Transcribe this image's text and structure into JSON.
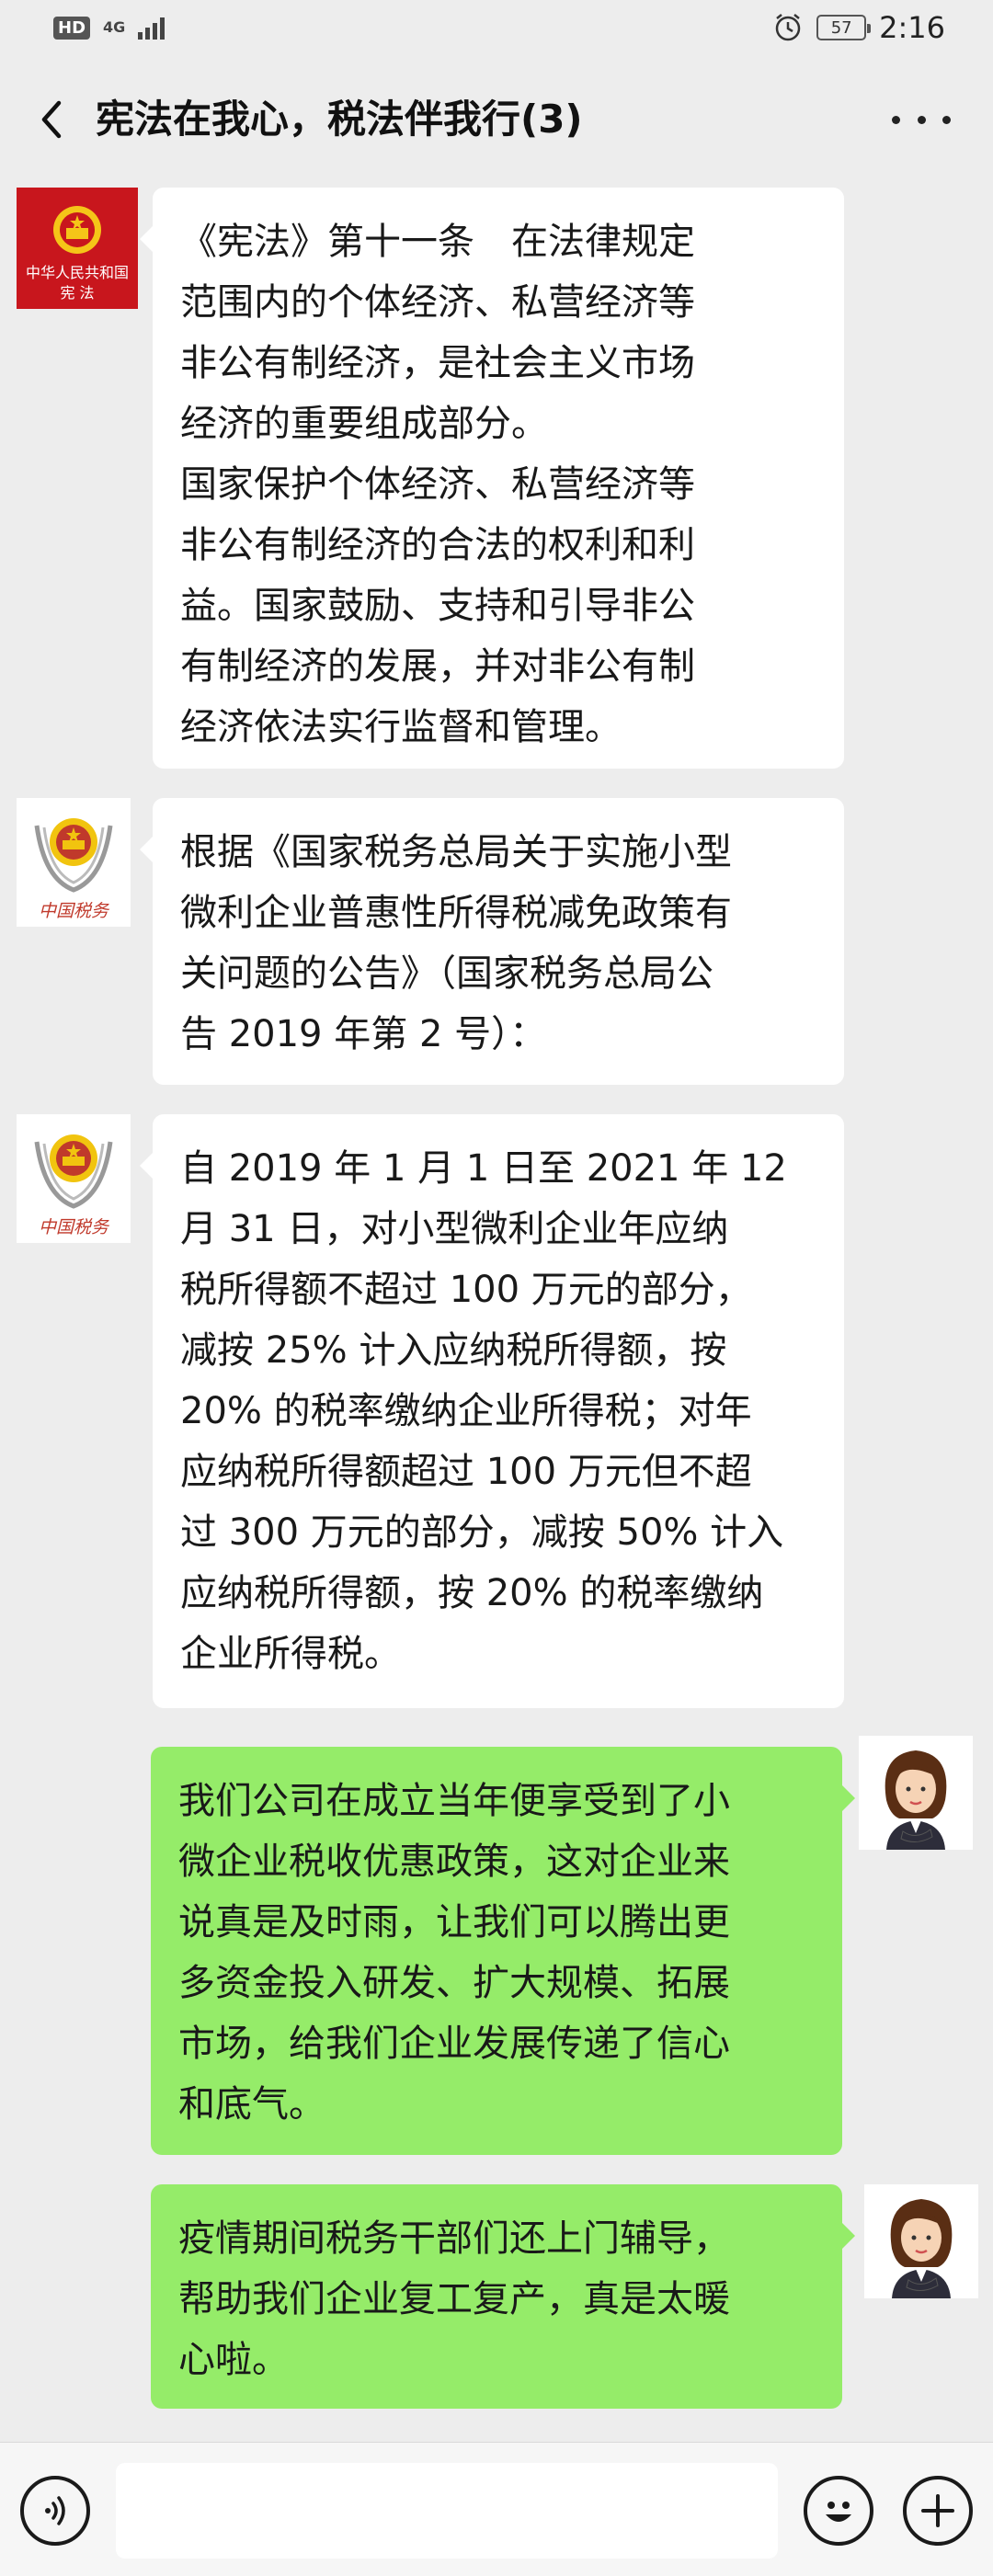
{
  "status_bar": {
    "hd_badge": "HD",
    "network": "4G",
    "battery": "57",
    "time": "2:16",
    "icons": [
      "signal-icon",
      "alarm-clock-icon",
      "battery-icon"
    ]
  },
  "header": {
    "title": "宪法在我心，税法伴我行(3)",
    "back_icon": "chevron-left-icon",
    "more_icon": "more-dots-icon"
  },
  "messages": [
    {
      "side": "left",
      "avatar": "constitution-book-avatar",
      "avatar_text": "中华人民共和国 宪 法",
      "text": "《宪法》第十一条　在法律规定\n范围内的个体经济、私营经济等\n非公有制经济，是社会主义市场\n经济的重要组成部分。\n国家保护个体经济、私营经济等\n非公有制经济的合法的权利和利\n益。国家鼓励、支持和引导非公\n有制经济的发展，并对非公有制\n经济依法实行监督和管理。"
    },
    {
      "side": "left",
      "avatar": "china-tax-emblem-avatar",
      "avatar_text": "中国税务",
      "text": "根据《国家税务总局关于实施小型\n微利企业普惠性所得税减免政策有\n关问题的公告》（国家税务总局公\n告 2019 年第 2 号）："
    },
    {
      "side": "left",
      "avatar": "china-tax-emblem-avatar",
      "avatar_text": "中国税务",
      "text": "自 2019 年 1 月 1 日至 2021 年 12\n月 31 日，对小型微利企业年应纳\n税所得额不超过 100 万元的部分，\n减按 25% 计入应纳税所得额，按\n20% 的税率缴纳企业所得税；对年\n应纳税所得额超过 100 万元但不超\n过 300 万元的部分，减按 50% 计入\n应纳税所得额，按 20% 的税率缴纳\n企业所得税。"
    },
    {
      "side": "right",
      "avatar": "businesswoman-avatar",
      "text": "我们公司在成立当年便享受到了小\n微企业税收优惠政策，这对企业来\n说真是及时雨，让我们可以腾出更\n多资金投入研发、扩大规模、拓展\n市场，给我们企业发展传递了信心\n和底气。"
    },
    {
      "side": "right",
      "avatar": "businesswoman-avatar",
      "text": "疫情期间税务干部们还上门辅导，\n帮助我们企业复工复产，真是太暖\n心啦。"
    }
  ],
  "input_bar": {
    "voice_icon": "voice-icon",
    "emoji_icon": "emoji-icon",
    "plus_icon": "plus-icon",
    "placeholder": ""
  },
  "colors": {
    "background": "#ededed",
    "incoming_bubble": "#ffffff",
    "outgoing_bubble": "#95ec69",
    "constitution_red": "#c8161d",
    "tax_red": "#c0392b"
  }
}
